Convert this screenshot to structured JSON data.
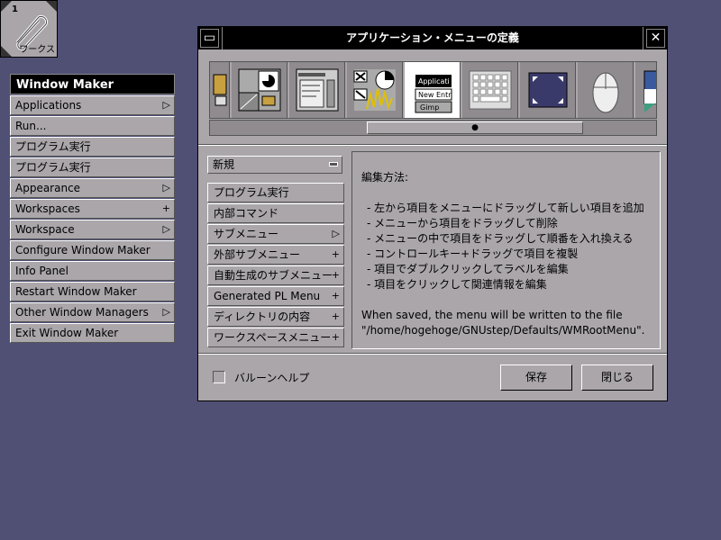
{
  "clip": {
    "number": "1",
    "label": "ワークス"
  },
  "root_menu": {
    "title": "Window Maker",
    "items": [
      {
        "label": "Applications",
        "mark": "▷"
      },
      {
        "label": "Run...",
        "mark": ""
      },
      {
        "label": "プログラム実行",
        "mark": ""
      },
      {
        "label": "プログラム実行",
        "mark": ""
      },
      {
        "label": "Appearance",
        "mark": "▷"
      },
      {
        "label": "Workspaces",
        "mark": "+"
      },
      {
        "label": "Workspace",
        "mark": "▷"
      },
      {
        "label": "Configure Window Maker",
        "mark": ""
      },
      {
        "label": "Info Panel",
        "mark": ""
      },
      {
        "label": "Restart Window Maker",
        "mark": ""
      },
      {
        "label": "Other Window Managers",
        "mark": "▷"
      },
      {
        "label": "Exit Window Maker",
        "mark": ""
      }
    ]
  },
  "dialog": {
    "title": "アプリケーション・メニューの定義",
    "close_glyph": "✕",
    "minimize_glyph": "▭",
    "icon_preview_texts": [
      "Applicati",
      "New Entr",
      "Gimp"
    ],
    "new_popup": "新規",
    "items": [
      {
        "label": "プログラム実行",
        "mark": ""
      },
      {
        "label": "内部コマンド",
        "mark": ""
      },
      {
        "label": "サブメニュー",
        "mark": "▷"
      },
      {
        "label": "外部サブメニュー",
        "mark": "+"
      },
      {
        "label": "自動生成のサブメニュー",
        "mark": "+"
      },
      {
        "label": "Generated PL Menu",
        "mark": "+"
      },
      {
        "label": "ディレクトリの内容",
        "mark": "+"
      },
      {
        "label": "ワークスペースメニュー",
        "mark": "+"
      }
    ],
    "info": {
      "heading": "編集方法:",
      "lines": [
        "- 左から項目をメニューにドラッグして新しい項目を追加",
        "- メニューから項目をドラッグして削除",
        "- メニューの中で項目をドラッグして順番を入れ換える",
        "- コントロールキー+ドラッグで項目を複製",
        "- 項目でダブルクリックしてラベルを編集",
        "- 項目をクリックして関連情報を編集"
      ],
      "saved_line1": "When saved, the menu will be written to the file",
      "saved_line2": "\"/home/hogehoge/GNUstep/Defaults/WMRootMenu\"."
    },
    "balloon_help": "バルーンヘルプ",
    "save_button": "保存",
    "close_button": "閉じる"
  }
}
